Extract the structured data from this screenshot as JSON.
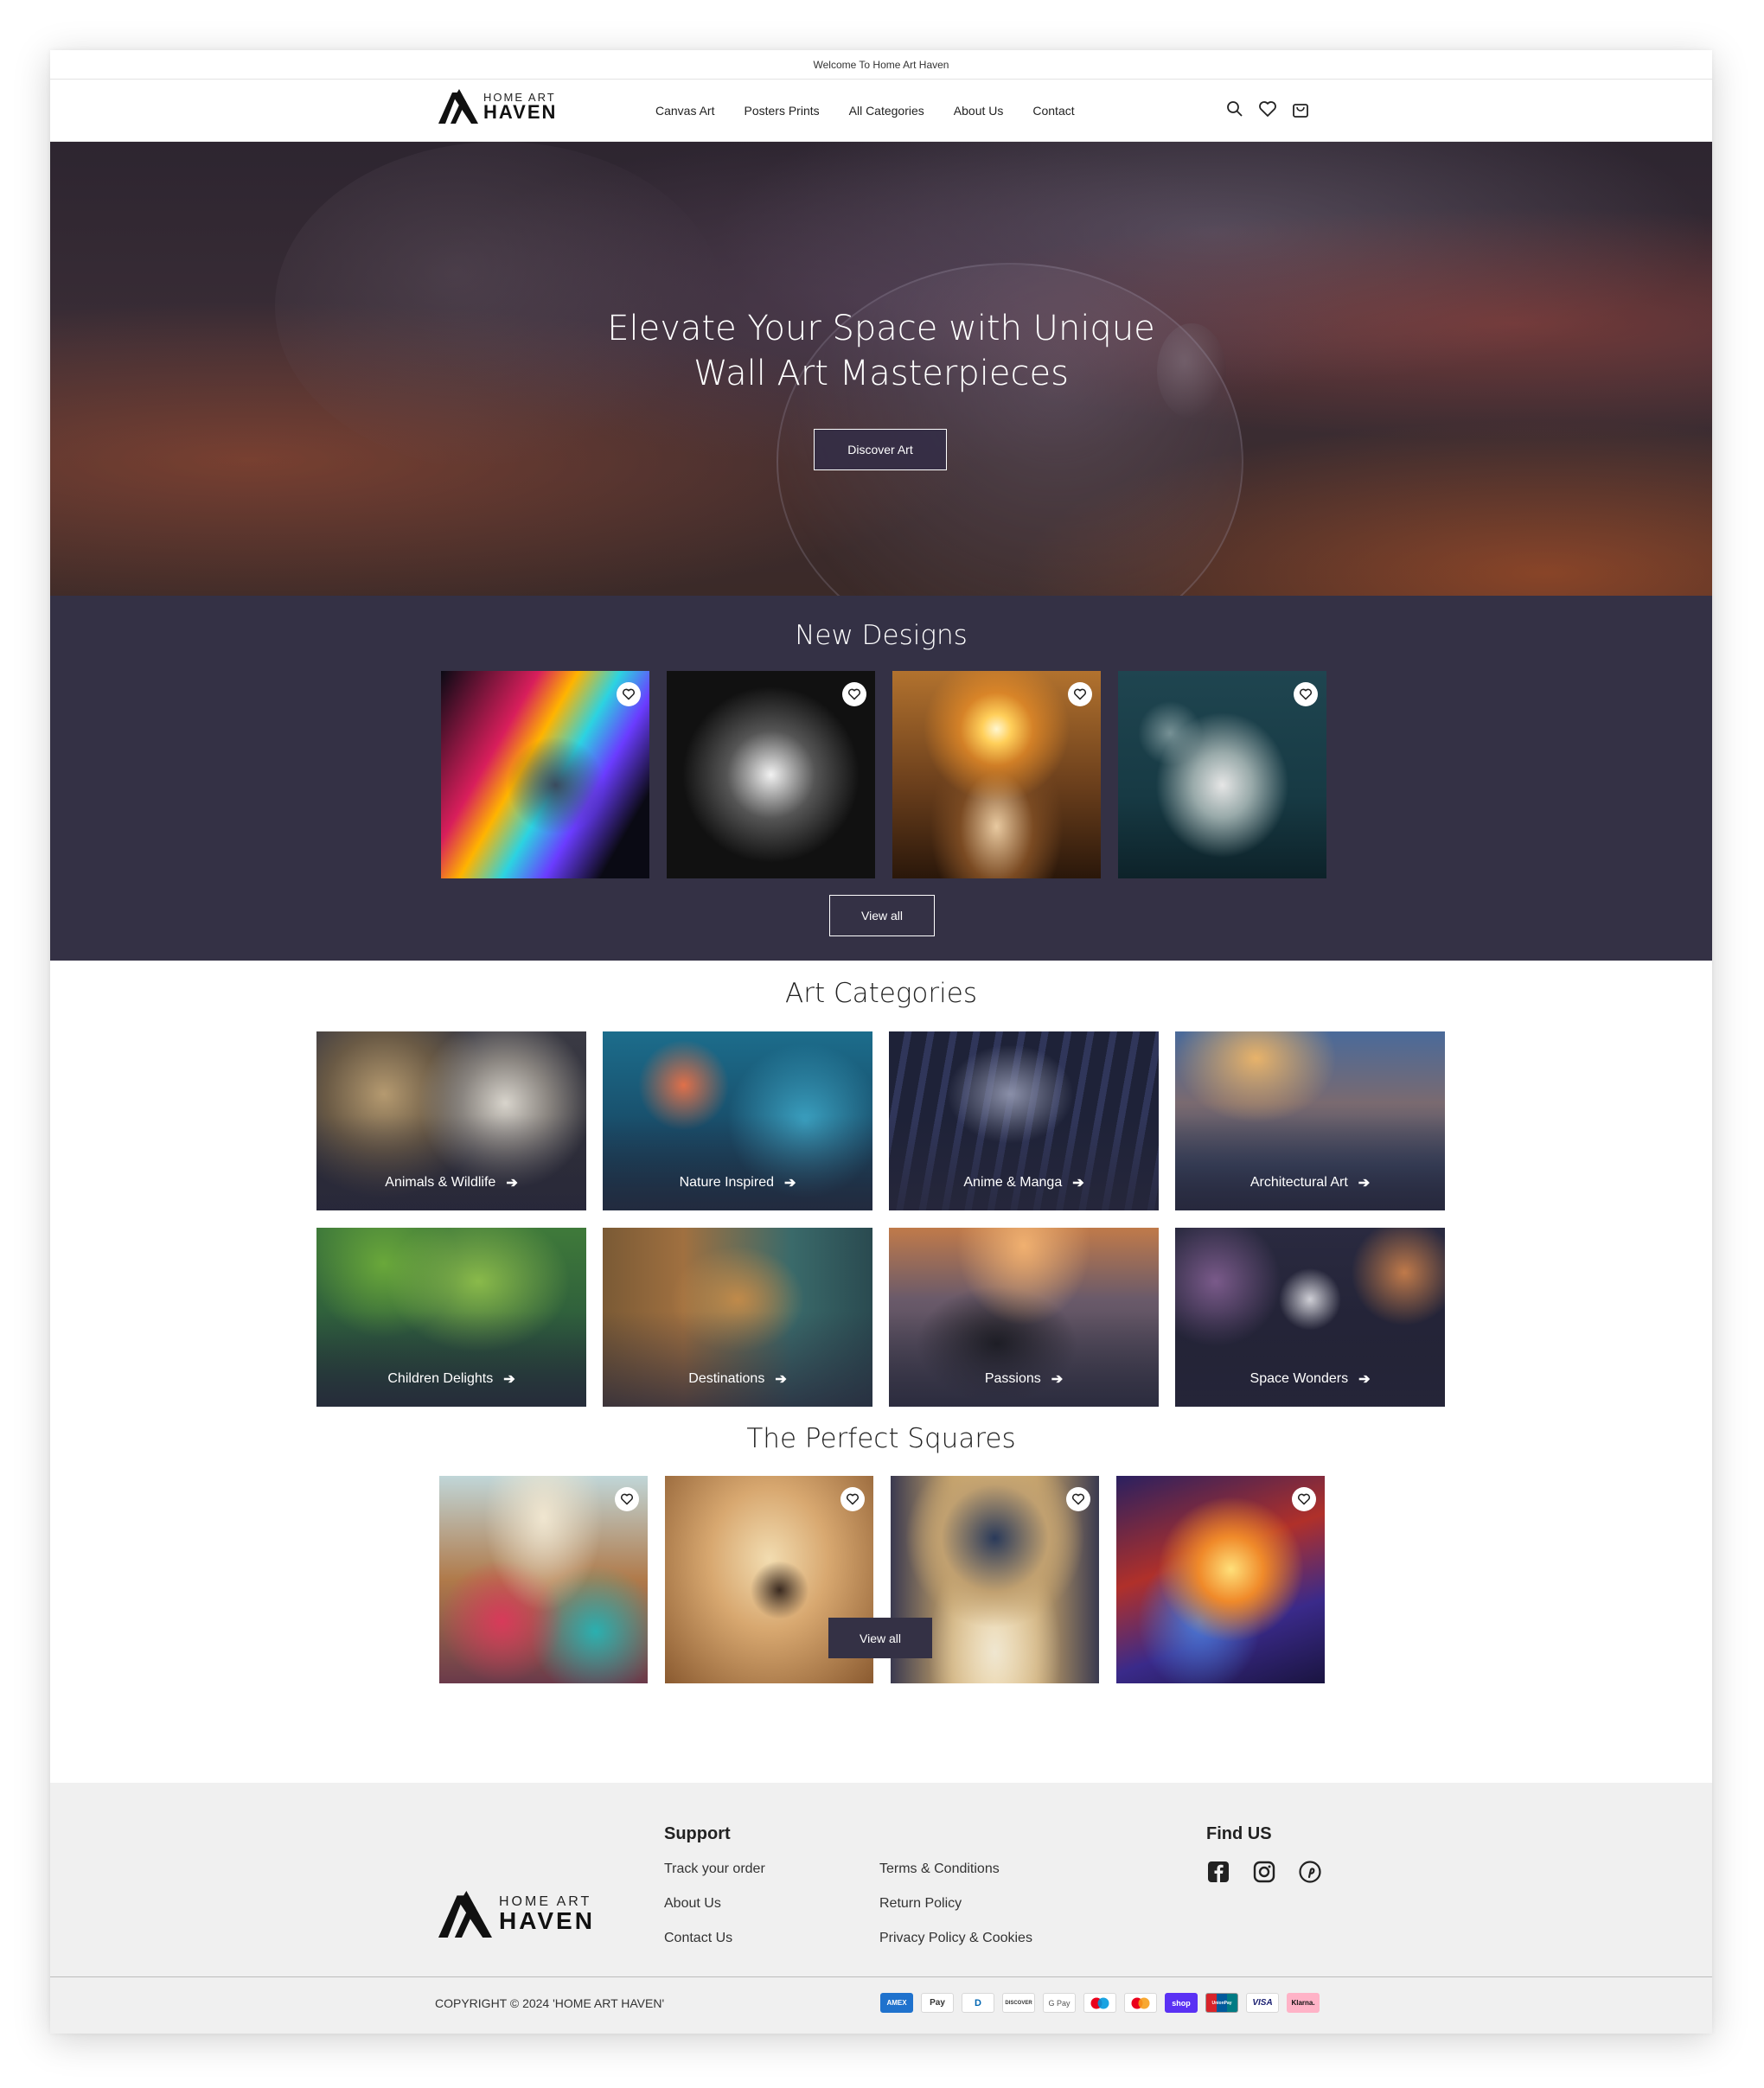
{
  "announcement": "Welcome To Home Art Haven",
  "brand": {
    "small": "HOME ART",
    "big": "HAVEN"
  },
  "nav": [
    "Canvas Art",
    "Posters Prints",
    "All Categories",
    "About Us",
    "Contact"
  ],
  "header_icons": [
    "search-icon",
    "heart-icon",
    "cart-icon"
  ],
  "hero": {
    "title_line1": "Elevate Your Space with Unique",
    "title_line2": "Wall Art Masterpieces",
    "button": "Discover Art"
  },
  "new_designs": {
    "title": "New Designs",
    "view_all": "View all"
  },
  "categories": {
    "title": "Art Categories",
    "items": [
      "Animals & Wildlife",
      "Nature Inspired",
      "Anime & Manga",
      "Architectural Art",
      "Children Delights",
      "Destinations",
      "Passions",
      "Space Wonders"
    ]
  },
  "squares": {
    "title": "The Perfect Squares",
    "view_all": "View all"
  },
  "footer": {
    "support_heading": "Support",
    "support_col1": [
      "Track your order",
      "About Us",
      "Contact Us"
    ],
    "support_col2": [
      "Terms & Conditions",
      "Return Policy",
      "Privacy Policy & Cookies"
    ],
    "find_heading": "Find US",
    "socials": [
      "facebook-icon",
      "instagram-icon",
      "pinterest-icon"
    ],
    "copyright": "COPYRIGHT © 2024 'HOME ART HAVEN'",
    "payments": [
      "AMEX",
      "Pay",
      "D",
      "DISCOVER",
      "G Pay",
      "",
      "",
      "shop",
      "UnionPay",
      "VISA",
      "Klarna."
    ]
  },
  "colors": {
    "dark_section": "#343145",
    "footer_bg": "#f0f0f0"
  }
}
